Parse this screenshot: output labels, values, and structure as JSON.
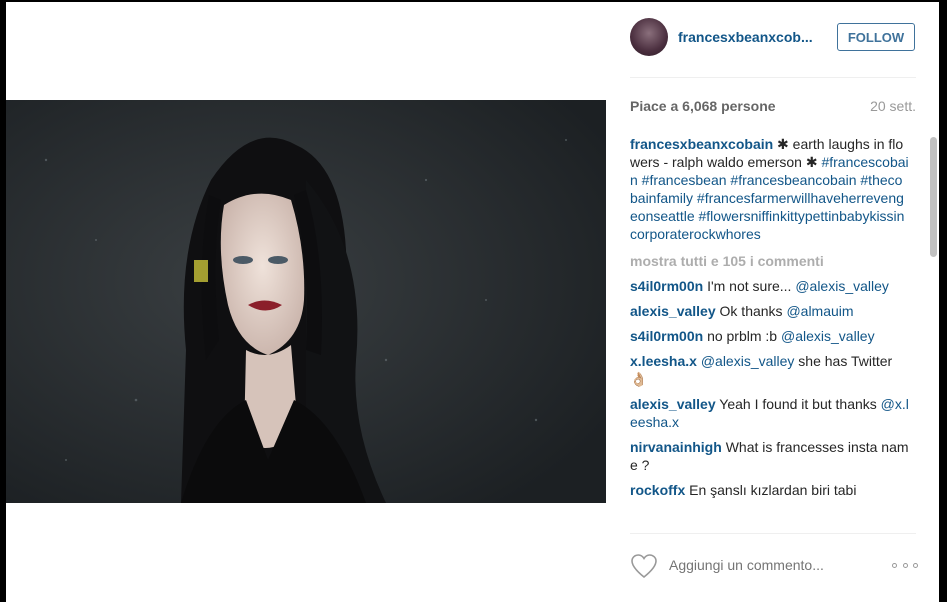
{
  "post": {
    "username": "francesxbeanxcob...",
    "follow_label": "FOLLOW",
    "likes_text": "Piace a 6,068 persone",
    "age_text": "20 sett.",
    "caption": {
      "user": "francesxbeanxcobain",
      "text": " ✱ earth laughs in flowers - ralph waldo emerson ✱ ",
      "hashtags": "#francescobain #francesbean #francesbeancobain #thecobainfamily #francesfarmerwillhaveherrevengeonseattle #flowersniffinkittypettinbabykissincorporaterockwhores"
    },
    "show_all_comments": "mostra tutti e 105 i commenti",
    "comments": [
      {
        "user": "s4il0rm00n",
        "text": "I'm not sure... ",
        "mention": "@alexis_valley"
      },
      {
        "user": "alexis_valley",
        "text": "Ok thanks ",
        "mention": "@almauim"
      },
      {
        "user": "s4il0rm00n",
        "text": "no prblm :b ",
        "mention": "@alexis_valley"
      },
      {
        "user": "x.leesha.x",
        "text": " she has Twitter 👌🏼",
        "mention_first": "@alexis_valley"
      },
      {
        "user": "alexis_valley",
        "text": "Yeah I found it but thanks ",
        "mention": "@x.leesha.x"
      },
      {
        "user": "nirvanainhigh",
        "text": "What is francesses insta name ?"
      },
      {
        "user": "rockoffx",
        "text": "En şanslı kızlardan biri tabi"
      }
    ],
    "comment_placeholder": "Aggiungi un commento...",
    "icons": {
      "like": "heart-outline-icon",
      "more": "more-options-icon"
    }
  },
  "colors": {
    "link": "#125688",
    "follow": "#3f729b",
    "muted": "#999999",
    "backdrop": "#000000"
  }
}
